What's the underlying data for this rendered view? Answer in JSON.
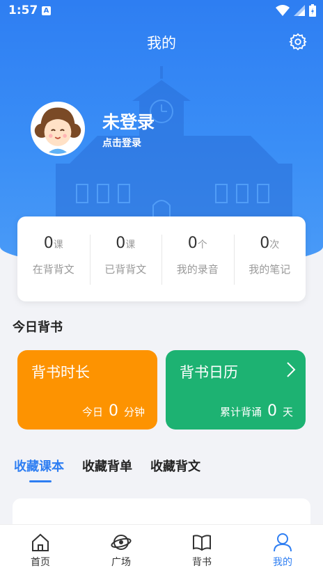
{
  "status_bar": {
    "time": "1:57",
    "notif_badge": "A"
  },
  "header": {
    "title": "我的"
  },
  "user": {
    "name": "未登录",
    "login_hint": "点击登录"
  },
  "stats": [
    {
      "value": "0",
      "unit": "课",
      "label": "在背背文"
    },
    {
      "value": "0",
      "unit": "课",
      "label": "已背背文"
    },
    {
      "value": "0",
      "unit": "个",
      "label": "我的录音"
    },
    {
      "value": "0",
      "unit": "次",
      "label": "我的笔记"
    }
  ],
  "today": {
    "section_title": "今日背书",
    "duration_tile": {
      "title": "背书时长",
      "prefix": "今日",
      "value": "0",
      "unit": "分钟"
    },
    "calendar_tile": {
      "title": "背书日历",
      "prefix": "累计背诵",
      "value": "0",
      "unit": "天"
    }
  },
  "tabs": [
    {
      "label": "收藏课本"
    },
    {
      "label": "收藏背单"
    },
    {
      "label": "收藏背文"
    }
  ],
  "bottom_nav": [
    {
      "label": "首页",
      "icon": "home-icon"
    },
    {
      "label": "广场",
      "icon": "planet-icon"
    },
    {
      "label": "背书",
      "icon": "book-icon"
    },
    {
      "label": "我的",
      "icon": "person-icon"
    }
  ],
  "colors": {
    "primary": "#2e7ef2",
    "orange": "#fd9301",
    "green": "#1db272"
  }
}
